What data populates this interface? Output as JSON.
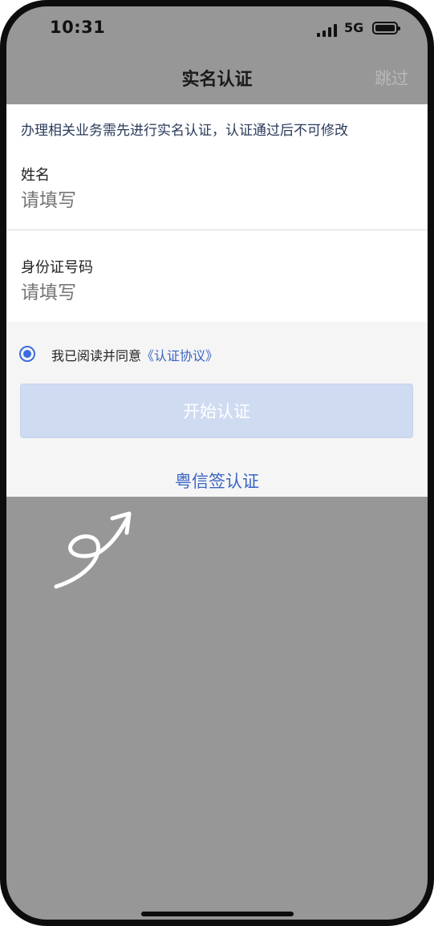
{
  "status": {
    "time": "10:31",
    "network": "5G"
  },
  "nav": {
    "title": "实名认证",
    "skip": "跳过"
  },
  "notice": "办理相关业务需先进行实名认证，认证通过后不可修改",
  "fields": {
    "name": {
      "label": "姓名",
      "placeholder": "请填写"
    },
    "id_number": {
      "label": "身份证号码",
      "placeholder": "请填写"
    }
  },
  "agreement": {
    "checked": true,
    "text": "我已阅读并同意",
    "link": "《认证协议》"
  },
  "start_button": "开始认证",
  "alt_link": "粤信签认证",
  "colors": {
    "accent": "#3b6de0",
    "button_disabled": "#cfdbf1",
    "overlay": "#979797"
  }
}
